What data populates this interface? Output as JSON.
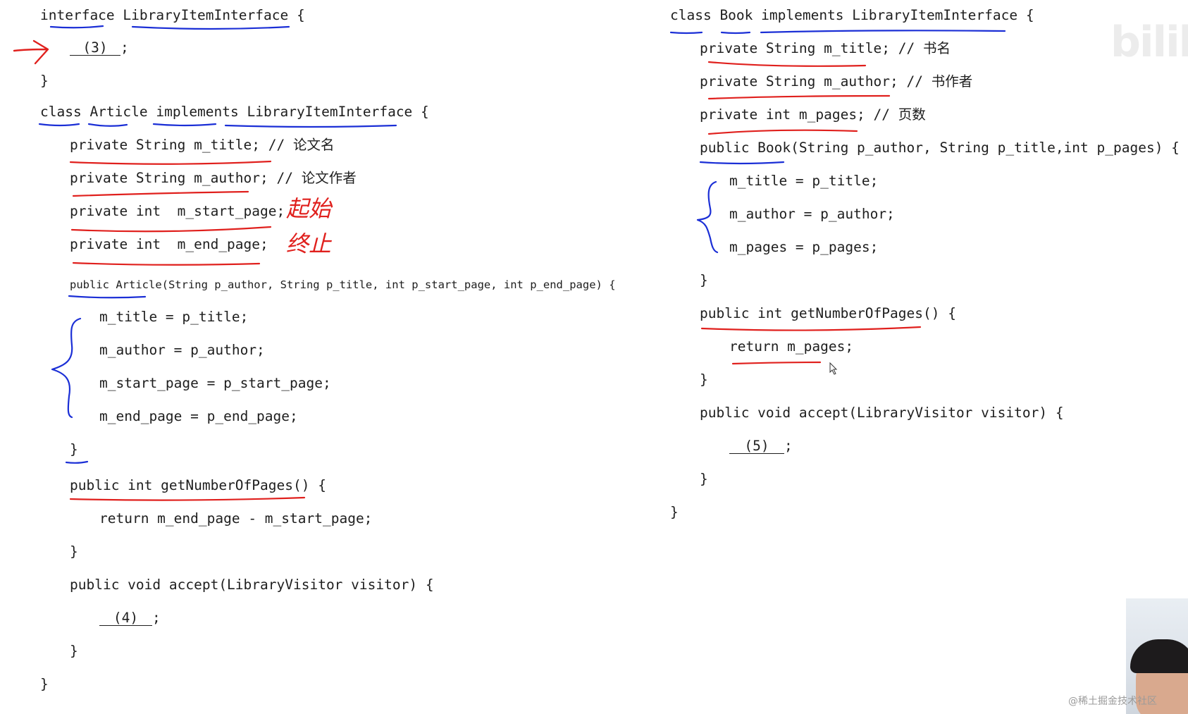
{
  "left": {
    "interface_line": "interface LibraryItemInterface {",
    "blank_3_label": "(3)",
    "semicolon": ";",
    "interface_close": "}",
    "class_line": "class Article implements LibraryItemInterface {",
    "field_title": "private String m_title; // 论文名",
    "field_author": "private String m_author; // 论文作者",
    "field_start_page": "private int  m_start_page;",
    "field_end_page": "private int  m_end_page;",
    "constructor_line": "public Article(String p_author, String p_title, int p_start_page, int p_end_page) {",
    "assign_title": "m_title = p_title;",
    "assign_author": "m_author = p_author;",
    "assign_start_page": "m_start_page = p_start_page;",
    "assign_end_page": "m_end_page = p_end_page;",
    "constructor_close": "}",
    "get_pages_line": "public int getNumberOfPages() {",
    "return_line": "return m_end_page - m_start_page;",
    "get_pages_close": "}",
    "accept_line": "public void accept(LibraryVisitor visitor) {",
    "blank_4_label": "(4)",
    "accept_close": "}",
    "class_close": "}"
  },
  "right": {
    "class_line": "class Book implements LibraryItemInterface {",
    "field_title": "private String m_title; // 书名",
    "field_author": "private String m_author; // 书作者",
    "field_pages": "private int m_pages; // 页数",
    "constructor_line": "public Book(String p_author, String p_title,int p_pages) {",
    "assign_title": "m_title = p_title;",
    "assign_author": "m_author = p_author;",
    "assign_pages": "m_pages = p_pages;",
    "constructor_close": "}",
    "get_pages_line": "public int getNumberOfPages() {",
    "return_line": "return m_pages;",
    "get_pages_close": "}",
    "accept_line": "public void accept(LibraryVisitor visitor) {",
    "blank_5_label": "(5)",
    "accept_close": "}",
    "class_close": "}"
  },
  "annotations": {
    "start_note": "起始",
    "end_note": "终止"
  },
  "overlay": {
    "logo_text": "bilibili",
    "watermark": "@稀土掘金技术社区"
  },
  "colors": {
    "code": "#1e1e1e",
    "red_ink": "#e0201d",
    "blue_ink": "#1b2fd6"
  }
}
